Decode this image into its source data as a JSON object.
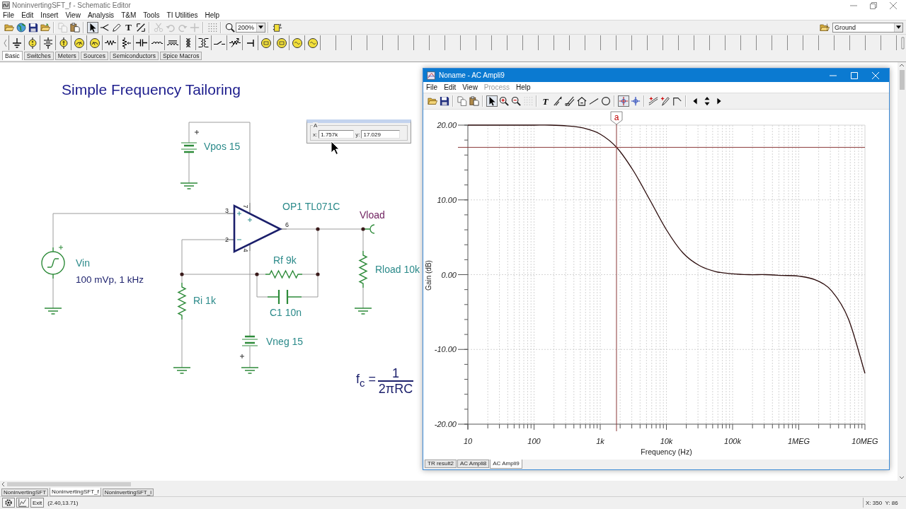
{
  "window": {
    "title": "NoninvertingSFT_f - Schematic Editor"
  },
  "menu": [
    "File",
    "Edit",
    "Insert",
    "View",
    "Analysis",
    "T&M",
    "Tools",
    "TI Utilities",
    "Help"
  ],
  "toolbar": {
    "groups": [
      [
        {
          "kind": "open",
          "disabled": false,
          "pressed": false
        },
        {
          "kind": "web",
          "disabled": false,
          "pressed": false
        },
        {
          "kind": "save",
          "disabled": false,
          "pressed": false
        },
        {
          "kind": "open-project",
          "disabled": false,
          "pressed": false
        }
      ],
      [
        {
          "kind": "copy",
          "disabled": true,
          "pressed": false
        },
        {
          "kind": "paste",
          "disabled": false,
          "pressed": false
        }
      ],
      [
        {
          "kind": "select",
          "disabled": false,
          "pressed": true
        },
        {
          "kind": "wire",
          "disabled": false,
          "pressed": false
        },
        {
          "kind": "pen",
          "disabled": false,
          "pressed": false
        },
        {
          "kind": "text",
          "glyph": "T",
          "disabled": false,
          "pressed": false
        },
        {
          "kind": "scale",
          "disabled": false,
          "pressed": false
        }
      ],
      [
        {
          "kind": "cut",
          "disabled": true,
          "pressed": false
        },
        {
          "kind": "undo",
          "disabled": true,
          "pressed": false
        },
        {
          "kind": "redo",
          "disabled": true,
          "pressed": false
        },
        {
          "kind": "cross",
          "disabled": true,
          "pressed": false
        }
      ],
      [
        {
          "kind": "grid",
          "disabled": false,
          "pressed": false
        }
      ],
      [
        {
          "kind": "zoom",
          "disabled": false,
          "pressed": false
        }
      ],
      [
        {
          "kind": "properties",
          "disabled": false,
          "pressed": false
        }
      ]
    ],
    "zoom_value": "200%",
    "component_value": "Ground"
  },
  "palette": {
    "items": [
      {
        "kind": "ground"
      },
      {
        "kind": "voltage-source"
      },
      {
        "kind": "battery"
      },
      {
        "kind": "current-source"
      },
      {
        "kind": "voltmeter"
      },
      {
        "kind": "ammeter"
      },
      {
        "kind": "resistor"
      },
      {
        "kind": "potentiometer"
      },
      {
        "kind": "capacitor"
      },
      {
        "kind": "inductor"
      },
      {
        "kind": "core-inductor"
      },
      {
        "kind": "transformer"
      },
      {
        "kind": "coupled-inductor"
      },
      {
        "kind": "switch"
      },
      {
        "kind": "variable-resistor"
      },
      {
        "kind": "terminal"
      },
      {
        "kind": "ic-source"
      },
      {
        "kind": "ic-source"
      },
      {
        "kind": "ns-source"
      },
      {
        "kind": "ns-source"
      }
    ],
    "tabs": [
      {
        "label": "Basic",
        "selected": true
      },
      {
        "label": "Switches",
        "selected": false
      },
      {
        "label": "Meters",
        "selected": false
      },
      {
        "label": "Sources",
        "selected": false
      },
      {
        "label": "Semiconductors",
        "selected": false
      },
      {
        "label": "Spice Macros",
        "selected": false
      }
    ]
  },
  "schematic": {
    "title": "Simple Frequency Tailoring",
    "components": [
      {
        "kind": "battery",
        "label": "Vpos 15"
      },
      {
        "kind": "op-amp",
        "label": "OP1 TL071C",
        "pins": [
          "3",
          "2",
          "7",
          "4",
          "6"
        ]
      },
      {
        "kind": "output",
        "label": "Vload"
      },
      {
        "kind": "sine-source",
        "label": "Vin",
        "value": "100 mVp, 1 kHz"
      },
      {
        "kind": "resistor",
        "label": "Rf 9k"
      },
      {
        "kind": "resistor",
        "label": "Rload 10k"
      },
      {
        "kind": "resistor",
        "label": "Ri 1k"
      },
      {
        "kind": "capacitor",
        "label": "C1 10n"
      },
      {
        "kind": "battery",
        "label": "Vneg 15"
      }
    ],
    "formula": {
      "lhs": "f$_{c}$ =",
      "numerator": "1",
      "denominator": "2πRC"
    },
    "cursor_readout": {
      "group": "A",
      "x_label": "x:",
      "x_value": "1.757k",
      "y_label": "y:",
      "y_value": "17.029"
    }
  },
  "graph_window": {
    "title": "Noname - AC Ampli9",
    "menu": [
      {
        "label": "File",
        "disabled": false
      },
      {
        "label": "Edit",
        "disabled": false
      },
      {
        "label": "View",
        "disabled": false
      },
      {
        "label": "Process",
        "disabled": true
      },
      {
        "label": "Help",
        "disabled": false
      }
    ],
    "toolbar": {
      "groups": [
        [
          {
            "kind": "open",
            "disabled": false,
            "pressed": false
          },
          {
            "kind": "save",
            "disabled": false,
            "pressed": false
          }
        ],
        [
          {
            "kind": "copy",
            "disabled": false,
            "pressed": false
          },
          {
            "kind": "paste",
            "disabled": false,
            "pressed": false
          }
        ],
        [
          {
            "kind": "select",
            "disabled": false,
            "pressed": true
          },
          {
            "kind": "zoom-in",
            "disabled": false,
            "pressed": false
          },
          {
            "kind": "zoom-out",
            "disabled": false,
            "pressed": false
          },
          {
            "kind": "grid",
            "disabled": true,
            "pressed": false
          }
        ],
        [
          {
            "kind": "text",
            "glyph": "T",
            "disabled": false,
            "pressed": false
          },
          {
            "kind": "cursor-tool",
            "disabled": false,
            "pressed": false
          },
          {
            "kind": "cursor-tool-2",
            "disabled": false,
            "pressed": false
          },
          {
            "kind": "plot-tool",
            "disabled": false,
            "pressed": false
          },
          {
            "kind": "line",
            "disabled": false,
            "pressed": false
          },
          {
            "kind": "circle",
            "disabled": false,
            "pressed": false
          }
        ],
        [
          {
            "kind": "cursor-a",
            "disabled": false,
            "pressed": true
          },
          {
            "kind": "cursor-b",
            "disabled": false,
            "pressed": false
          }
        ],
        [
          {
            "kind": "curve-plus",
            "disabled": false,
            "pressed": false
          },
          {
            "kind": "pen-plus",
            "disabled": false,
            "pressed": false
          },
          {
            "kind": "angle",
            "disabled": false,
            "pressed": false
          }
        ],
        [
          {
            "kind": "step-left",
            "disabled": false,
            "pressed": false
          },
          {
            "kind": "step-updown",
            "disabled": false,
            "pressed": false
          },
          {
            "kind": "step-right",
            "disabled": false,
            "pressed": false
          }
        ]
      ]
    },
    "chart_data": {
      "type": "line",
      "xlabel": "Frequency (Hz)",
      "ylabel": "Gain (dB)",
      "grid": true,
      "categories": [
        "10",
        null,
        null,
        null,
        "100",
        null,
        null,
        null,
        "1k",
        null,
        null,
        null,
        "10k",
        null,
        null,
        null,
        "100k",
        null,
        null,
        null,
        "1MEG",
        null,
        null,
        null,
        "10MEG"
      ],
      "series": [
        {
          "color": "#2a0a0a",
          "values": [
            20.0,
            20.0,
            20.0,
            20.0,
            20.0,
            20.0,
            19.9,
            19.6,
            18.8,
            17.0,
            13.9,
            10.0,
            6.0,
            2.9,
            1.2,
            0.4,
            0.1,
            0.0,
            0.0,
            -0.1,
            -0.2,
            -0.7,
            -2.2,
            -5.9,
            -13.2
          ]
        }
      ],
      "ylim": [
        -20,
        20
      ],
      "yticks": [
        {
          "value": -20,
          "label": "-20.00"
        },
        {
          "value": -10,
          "label": "-10.00"
        },
        {
          "value": 0,
          "label": "0.00"
        },
        {
          "value": 10,
          "label": "10.00"
        },
        {
          "value": 20,
          "label": "20.00"
        }
      ],
      "ref_lines": [
        {
          "axis": "y",
          "value": 17.029
        }
      ],
      "annotations": [
        "a"
      ]
    },
    "tabs": [
      {
        "label": "TR result2",
        "selected": false
      },
      {
        "label": "AC Ampli8",
        "selected": false
      },
      {
        "label": "AC Ampli9",
        "selected": true
      }
    ]
  },
  "document_tabs": [
    {
      "label": "NoninvertingSFT",
      "selected": false
    },
    {
      "label": "NoninvertingSFT_f",
      "selected": true
    },
    {
      "label": "NoninvertingSFT_i",
      "selected": false
    }
  ],
  "status_bar": {
    "exit": "Exit",
    "coordinates": "(2.40,13.71)",
    "position": "X: 350  Y: 86"
  }
}
